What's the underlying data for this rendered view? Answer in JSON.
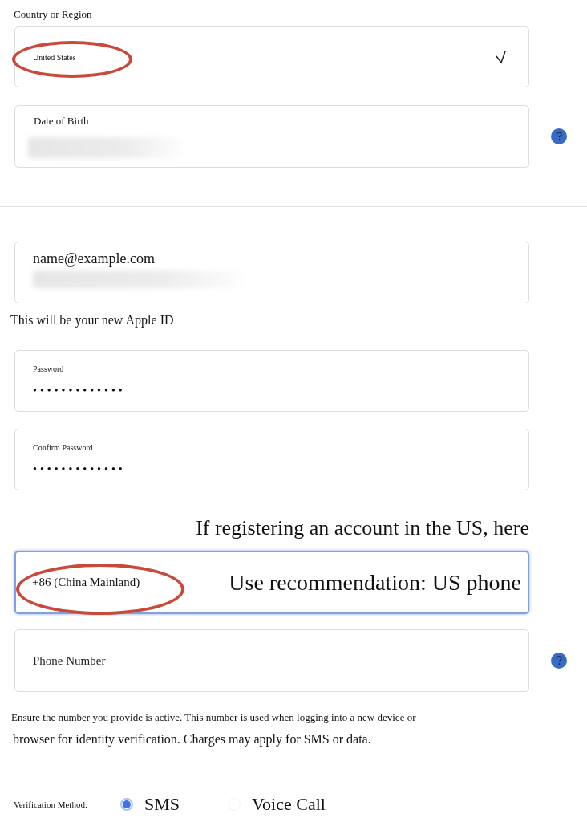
{
  "country_region": {
    "label": "Country or Region",
    "value": "United States",
    "circled": true
  },
  "date_of_birth": {
    "label": "Date of Birth",
    "redacted": true,
    "help": true
  },
  "email": {
    "value": "name@example.com",
    "redacted": true
  },
  "email_note": "This will be your new Apple ID",
  "password": {
    "label": "Password",
    "masked": "•••••••••••••"
  },
  "confirm_password": {
    "label": "Confirm Password",
    "masked": "•••••••••••••"
  },
  "annotation_top": "If registering an account in the US, here",
  "phone_code": {
    "value": "+86 (China Mainland)",
    "focused": true,
    "circled": true,
    "annotation": "Use recommendation: US phone"
  },
  "phone_number": {
    "placeholder": "Phone Number",
    "help": true
  },
  "phone_note": [
    "Ensure the number you provide is active. This number is used when logging into a new device or",
    "browser for identity verification. Charges may apply for SMS or data."
  ],
  "verification": {
    "label": "Verification Method:",
    "options": [
      {
        "label": "SMS",
        "selected": true
      },
      {
        "label": "Voice Call",
        "selected": false
      }
    ]
  }
}
